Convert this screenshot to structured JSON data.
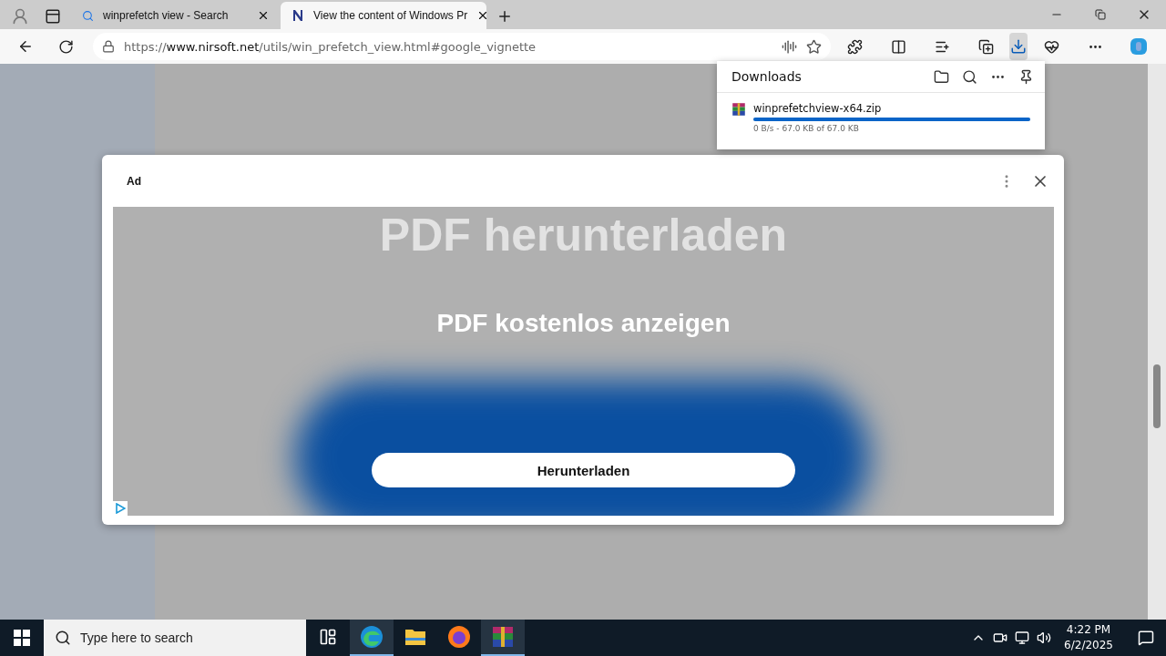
{
  "tabs": [
    {
      "title": "winprefetch view - Search",
      "kind": "search",
      "selected": false
    },
    {
      "title": "View the content of Windows Pr",
      "kind": "site",
      "selected": true
    }
  ],
  "address": {
    "scheme": "https://",
    "domain": "www.nirsoft.net",
    "path": "/utils/win_prefetch_view.html#google_vignette"
  },
  "downloads": {
    "title": "Downloads",
    "items": [
      {
        "file": "winprefetchview-x64.zip",
        "level": 1,
        "status": "0 B/s - 67.0 KB of 67.0 KB"
      }
    ]
  },
  "ad": {
    "label": "Ad",
    "faded_headlines": [
      "PDF herunterladen"
    ],
    "headline": "PDF kostenlos anzeigen",
    "button": "Herunterladen"
  },
  "taskbar": {
    "search_placeholder": "Type here to search",
    "apps": [
      {
        "kind": "taskview",
        "active": false
      },
      {
        "kind": "edge",
        "active": true
      },
      {
        "kind": "explorer",
        "active": false
      },
      {
        "kind": "firefox",
        "active": false
      },
      {
        "kind": "winrar",
        "active": true
      }
    ],
    "time": "4:22 PM",
    "date": "6/2/2025"
  }
}
